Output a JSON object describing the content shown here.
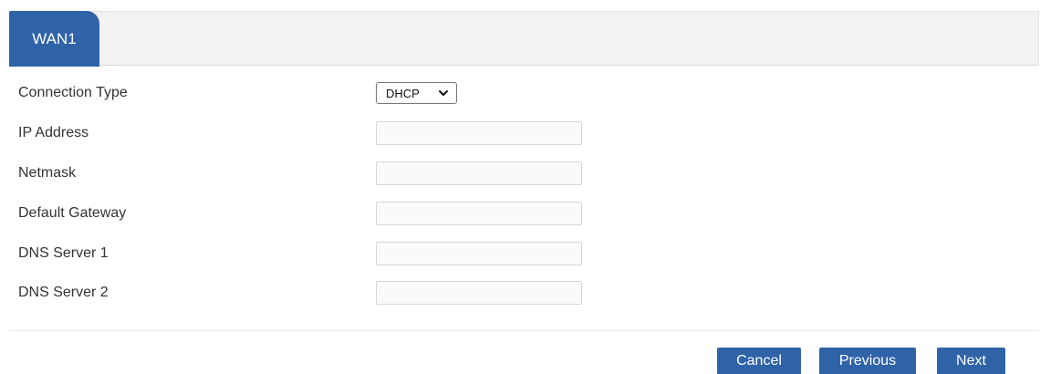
{
  "tabs": [
    {
      "label": "WAN1",
      "active": true
    }
  ],
  "form": {
    "connection_type": {
      "label": "Connection Type",
      "value": "DHCP",
      "options": [
        "DHCP"
      ]
    },
    "ip_address": {
      "label": "IP Address",
      "value": ""
    },
    "netmask": {
      "label": "Netmask",
      "value": ""
    },
    "default_gateway": {
      "label": "Default Gateway",
      "value": ""
    },
    "dns_server_1": {
      "label": "DNS Server 1",
      "value": ""
    },
    "dns_server_2": {
      "label": "DNS Server 2",
      "value": ""
    }
  },
  "buttons": {
    "cancel": "Cancel",
    "previous": "Previous",
    "next": "Next"
  },
  "icons": {
    "select_arrow": "chevron-down-icon"
  },
  "colors": {
    "accent": "#2f63a8",
    "tabbar_bg": "#f2f2f2",
    "input_bg": "#fafafa"
  }
}
